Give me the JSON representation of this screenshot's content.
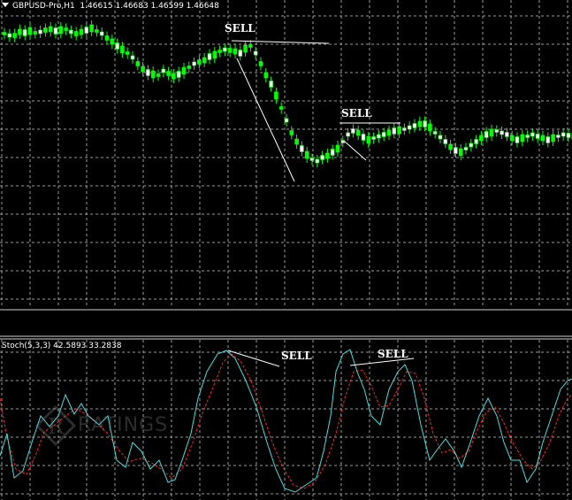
{
  "main_panel": {
    "symbol_label": "GBPUSD-Pro,H1",
    "ohlc": "1.46615 1.46683 1.46599 1.46648",
    "annotation_1": "SELL",
    "annotation_2": "SELL"
  },
  "indicator_panel": {
    "label": "Stoch(5,3,3) 42.5893 33.2838",
    "annotation_1": "SELL",
    "annotation_2": "SELL"
  },
  "watermark": {
    "logo_letter": "R",
    "text": "RATINGS"
  },
  "colors": {
    "background": "#000000",
    "grid": "#9a9a9a",
    "bull_candle": "#ffffff",
    "bear_candle": "#00ff00",
    "main_line": "#40e0e0",
    "signal_line": "#ff2020",
    "annotation": "#ffffff"
  }
}
